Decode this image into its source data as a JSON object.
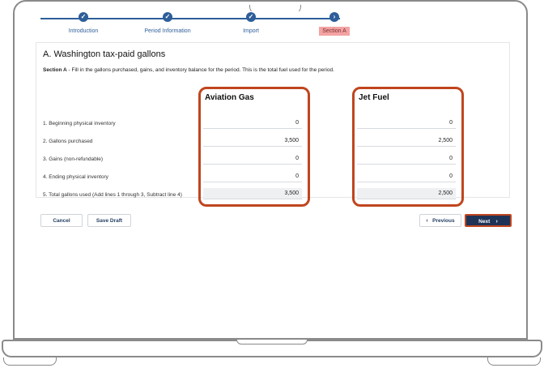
{
  "stepper": {
    "steps": [
      {
        "label": "Introduction",
        "icon": "check-icon",
        "state": "done"
      },
      {
        "label": "Period Information",
        "icon": "check-icon",
        "state": "done"
      },
      {
        "label": "Import",
        "icon": "check-icon",
        "state": "done"
      },
      {
        "label": "Section A",
        "icon": "chevron-right-icon",
        "state": "active"
      }
    ]
  },
  "section": {
    "title": "A. Washington tax-paid gallons",
    "desc_bold": "Section A",
    "desc_text": " - Fill in the gallons purchased, gains, and inventory balance for the period. This is the total fuel used for the period."
  },
  "columns": {
    "aviation": "Aviation Gas",
    "jet": "Jet Fuel"
  },
  "rows": [
    {
      "label": "1. Beginning physical inventory",
      "aviation": "0",
      "jet": "0"
    },
    {
      "label": "2. Gallons purchased",
      "aviation": "3,500",
      "jet": "2,500"
    },
    {
      "label": "3. Gains (non-refundable)",
      "aviation": "0",
      "jet": "0"
    },
    {
      "label": "4. Ending physical inventory",
      "aviation": "0",
      "jet": "0"
    },
    {
      "label": "5. Total gallons used (Add lines 1 through 3, Subtract line 4)",
      "aviation": "3,500",
      "jet": "2,500"
    }
  ],
  "footer": {
    "cancel": "Cancel",
    "save_draft": "Save Draft",
    "previous": "Previous",
    "next": "Next"
  },
  "colors": {
    "primary": "#2e5e99",
    "highlight": "#c0451e",
    "next_bg": "#1f3357",
    "active_step_bg": "#f4a3a3"
  }
}
